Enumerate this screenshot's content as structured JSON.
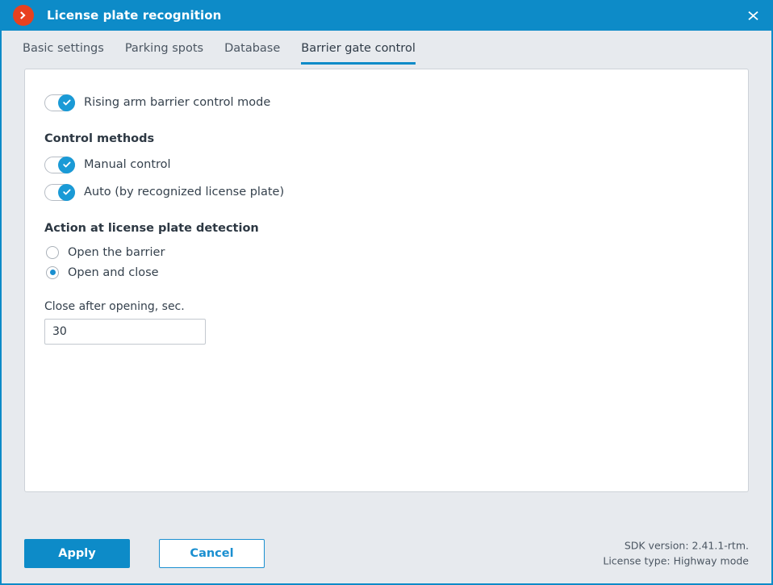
{
  "window": {
    "title": "License plate recognition",
    "logo_icon": "chevron-right-circle-icon",
    "close_icon": "close-icon",
    "accent_color": "#0d8bc8",
    "logo_color": "#e8411f"
  },
  "tabs": [
    {
      "label": "Basic settings",
      "active": false
    },
    {
      "label": "Parking spots",
      "active": false
    },
    {
      "label": "Database",
      "active": false
    },
    {
      "label": "Barrier gate control",
      "active": true
    }
  ],
  "main": {
    "master_toggle": {
      "label": "Rising arm barrier control mode",
      "checked": true
    },
    "control_methods": {
      "heading": "Control methods",
      "toggles": [
        {
          "label": "Manual control",
          "checked": true
        },
        {
          "label": "Auto (by recognized license plate)",
          "checked": true
        }
      ]
    },
    "detection_action": {
      "heading": "Action at license plate detection",
      "options": [
        {
          "label": "Open the barrier",
          "selected": false
        },
        {
          "label": "Open and close",
          "selected": true
        }
      ]
    },
    "close_after": {
      "label": "Close after opening, sec.",
      "value": "30",
      "placeholder": ""
    }
  },
  "footer": {
    "apply_label": "Apply",
    "cancel_label": "Cancel",
    "sdk_version": "SDK version: 2.41.1-rtm.",
    "license_type": "License type: Highway mode"
  }
}
